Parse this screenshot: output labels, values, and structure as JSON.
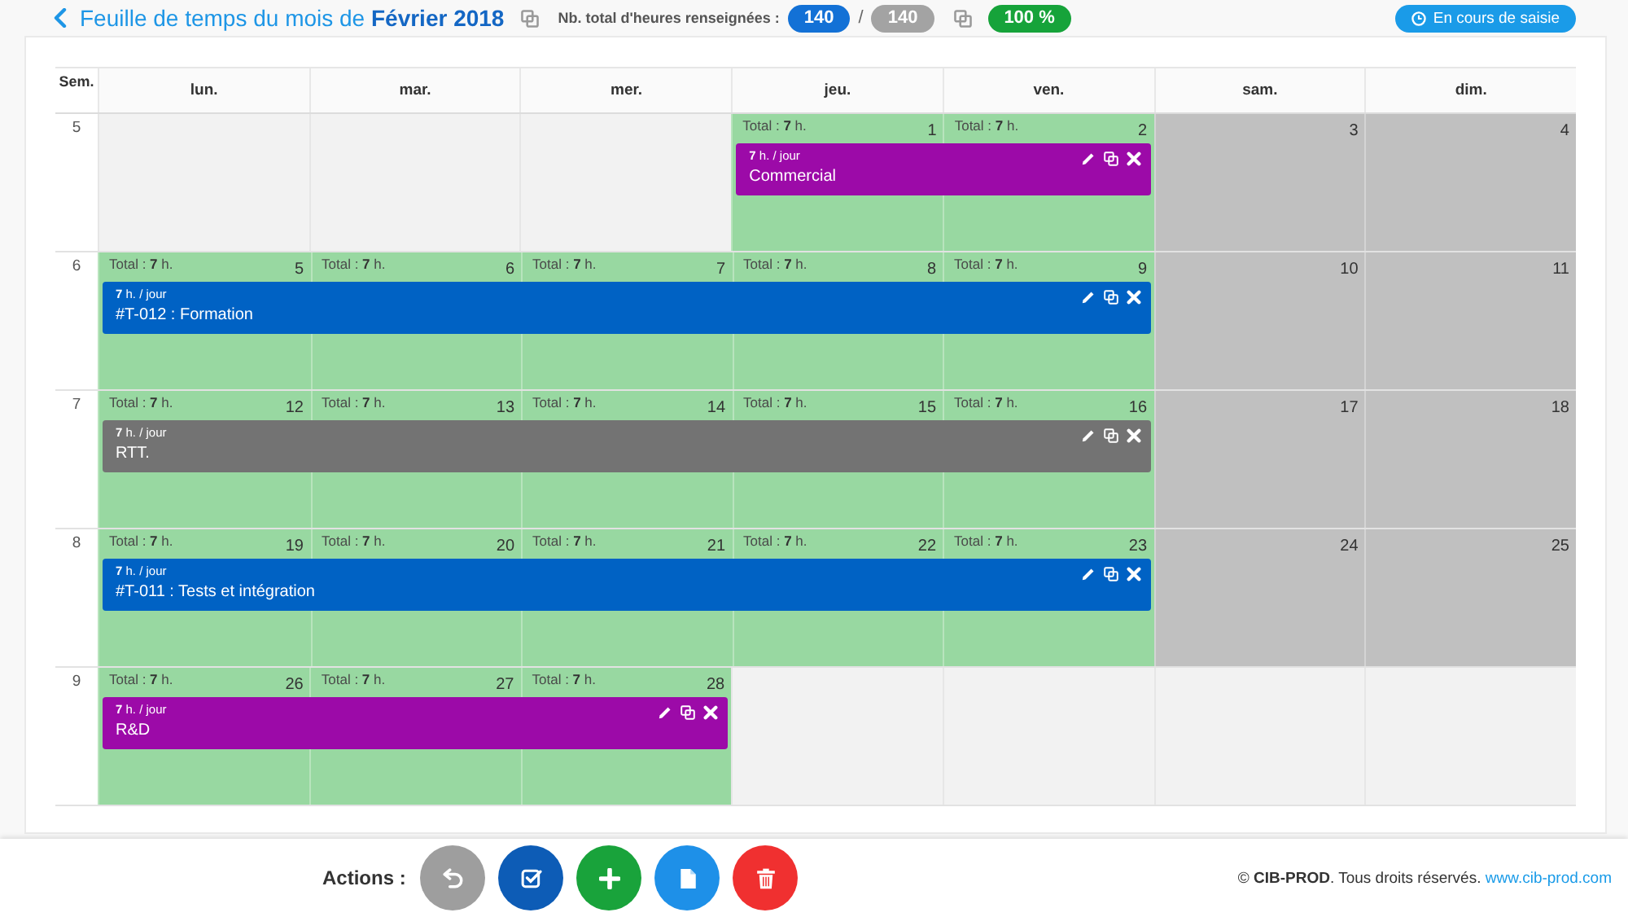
{
  "header": {
    "title": "Feuille de temps du mois de **Février 2018**",
    "hours_label": "Nb. total d'heures renseignées :",
    "hours_entered": "140",
    "hours_separator": "/",
    "hours_expected": "140",
    "completion": "100 %",
    "status": "En cours de saisie"
  },
  "calendar": {
    "week_heading": "Sem.",
    "weekdays": [
      "lun.",
      "mar.",
      "mer.",
      "jeu.",
      "ven.",
      "sam.",
      "dim."
    ],
    "weeks": [
      {
        "number": "5",
        "days": [
          {
            "kind": "outside"
          },
          {
            "kind": "outside"
          },
          {
            "kind": "outside"
          },
          {
            "kind": "workday",
            "total": "Total : **7** h.",
            "date": "1"
          },
          {
            "kind": "workday",
            "total": "Total : **7** h.",
            "date": "2"
          },
          {
            "kind": "weekend",
            "date": "3"
          },
          {
            "kind": "weekend",
            "date": "4"
          }
        ],
        "event": {
          "rate": "**7** h. / jour",
          "title": "Commercial",
          "color": "#9c0aa8"
        }
      },
      {
        "number": "6",
        "days": [
          {
            "kind": "workday",
            "total": "Total : **7** h.",
            "date": "5"
          },
          {
            "kind": "workday",
            "total": "Total : **7** h.",
            "date": "6"
          },
          {
            "kind": "workday",
            "total": "Total : **7** h.",
            "date": "7"
          },
          {
            "kind": "workday",
            "total": "Total : **7** h.",
            "date": "8"
          },
          {
            "kind": "workday",
            "total": "Total : **7** h.",
            "date": "9"
          },
          {
            "kind": "weekend",
            "date": "10"
          },
          {
            "kind": "weekend",
            "date": "11"
          }
        ],
        "event": {
          "rate": "**7** h. / jour",
          "title": "#T-012 : Formation",
          "color": "#0062c4"
        }
      },
      {
        "number": "7",
        "days": [
          {
            "kind": "workday",
            "total": "Total : **7** h.",
            "date": "12"
          },
          {
            "kind": "workday",
            "total": "Total : **7** h.",
            "date": "13"
          },
          {
            "kind": "workday",
            "total": "Total : **7** h.",
            "date": "14"
          },
          {
            "kind": "workday",
            "total": "Total : **7** h.",
            "date": "15"
          },
          {
            "kind": "workday",
            "total": "Total : **7** h.",
            "date": "16"
          },
          {
            "kind": "weekend",
            "date": "17"
          },
          {
            "kind": "weekend",
            "date": "18"
          }
        ],
        "event": {
          "rate": "**7** h. / jour",
          "title": "RTT.",
          "color": "#737373"
        }
      },
      {
        "number": "8",
        "days": [
          {
            "kind": "workday",
            "total": "Total : **7** h.",
            "date": "19"
          },
          {
            "kind": "workday",
            "total": "Total : **7** h.",
            "date": "20"
          },
          {
            "kind": "workday",
            "total": "Total : **7** h.",
            "date": "21"
          },
          {
            "kind": "workday",
            "total": "Total : **7** h.",
            "date": "22"
          },
          {
            "kind": "workday",
            "total": "Total : **7** h.",
            "date": "23"
          },
          {
            "kind": "weekend",
            "date": "24"
          },
          {
            "kind": "weekend",
            "date": "25"
          }
        ],
        "event": {
          "rate": "**7** h. / jour",
          "title": "#T-011 : Tests et intégration",
          "color": "#0062c4"
        }
      },
      {
        "number": "9",
        "days": [
          {
            "kind": "workday",
            "total": "Total : **7** h.",
            "date": "26"
          },
          {
            "kind": "workday",
            "total": "Total : **7** h.",
            "date": "27"
          },
          {
            "kind": "workday",
            "total": "Total : **7** h.",
            "date": "28"
          },
          {
            "kind": "outside"
          },
          {
            "kind": "outside"
          },
          {
            "kind": "outside"
          },
          {
            "kind": "outside"
          }
        ],
        "event": {
          "rate": "**7** h. / jour",
          "title": "R&D",
          "color": "#9c0aa8"
        }
      }
    ]
  },
  "actions": {
    "label": "Actions :",
    "buttons": [
      {
        "kind": "undo",
        "color": "#9e9e9e"
      },
      {
        "kind": "validate",
        "color": "#0d5cb6"
      },
      {
        "kind": "add",
        "color": "#19a33b"
      },
      {
        "kind": "document",
        "color": "#1e90e8"
      },
      {
        "kind": "delete",
        "color": "#f03030"
      }
    ]
  },
  "footer": {
    "copyright": "© **CIB-PROD**. Tous droits réservés.",
    "link": "www.cib-prod.com"
  }
}
